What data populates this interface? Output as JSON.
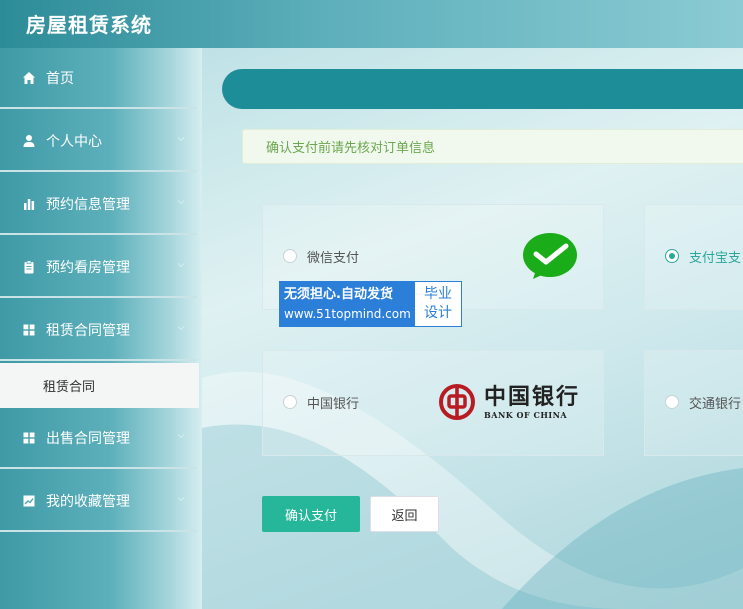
{
  "app": {
    "title": "房屋租赁系统"
  },
  "sidebar": {
    "items": [
      {
        "label": "首页",
        "icon": "home-icon"
      },
      {
        "label": "个人中心",
        "icon": "user-icon"
      },
      {
        "label": "预约信息管理",
        "icon": "bar-chart-icon"
      },
      {
        "label": "预约看房管理",
        "icon": "clipboard-icon"
      },
      {
        "label": "租赁合同管理",
        "icon": "grid-icon"
      },
      {
        "label": "出售合同管理",
        "icon": "grid-icon"
      },
      {
        "label": "我的收藏管理",
        "icon": "line-chart-icon"
      }
    ],
    "active_subitem": "租赁合同"
  },
  "notice": {
    "text": "确认支付前请先核对订单信息"
  },
  "payment": {
    "options": [
      {
        "label": "微信支付",
        "selected": false
      },
      {
        "label": "支付宝支",
        "selected": true
      },
      {
        "label": "中国银行",
        "selected": false
      },
      {
        "label": "交通银行",
        "selected": false
      }
    ],
    "boc_logo": {
      "cn": "中国银行",
      "en": "BANK OF CHINA"
    }
  },
  "watermark": {
    "line1": "无须担心.自动发货",
    "line2": "www.51topmind.com",
    "badge_line1": "毕业",
    "badge_line2": "设计"
  },
  "buttons": {
    "confirm": "确认支付",
    "back": "返回"
  },
  "colors": {
    "accent": "#26b79a",
    "header_bar": "#1d8e98",
    "wechat_green": "#1aad19",
    "boc_red": "#b81c22",
    "watermark_blue": "#2b7fd8"
  }
}
